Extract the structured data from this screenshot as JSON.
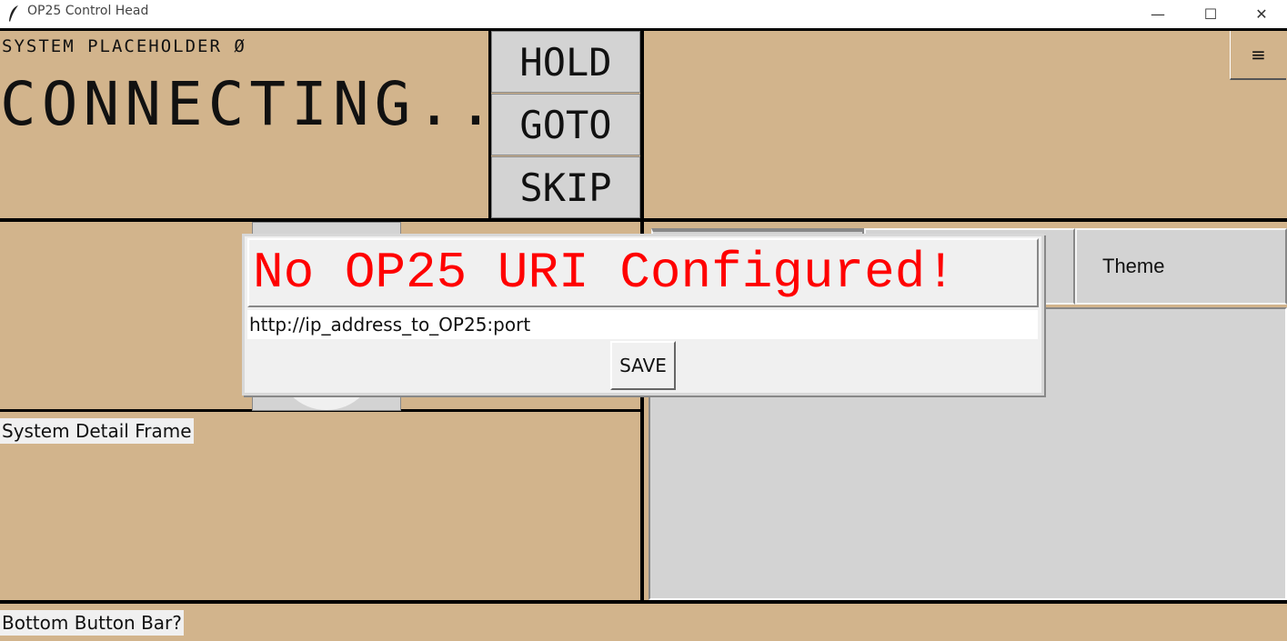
{
  "window": {
    "title": "OP25 Control Head",
    "app_icon": "feather-icon",
    "controls": {
      "minimize": "—",
      "maximize": "☐",
      "close": "✕"
    }
  },
  "scanner": {
    "system_name": "SYSTEM PLACEHOLDER Ø",
    "status": "CONNECTING...",
    "buttons": {
      "hold": "HOLD",
      "goto": "GOTO",
      "skip": "SKIP"
    }
  },
  "menu": {
    "icon": "≡"
  },
  "tabs": [
    {
      "label": ""
    },
    {
      "label": ""
    },
    {
      "label": "Theme"
    }
  ],
  "frames": {
    "system_detail": "System Detail Frame",
    "bottom_bar": "Bottom Button Bar?"
  },
  "dialog": {
    "title": "No OP25 URI Configured!",
    "uri_value": "http://ip_address_to_OP25:port",
    "save_label": "SAVE"
  },
  "colors": {
    "background": "#d2b48c",
    "button_gray": "#d3d3d3",
    "dialog_title": "#ff0000"
  }
}
